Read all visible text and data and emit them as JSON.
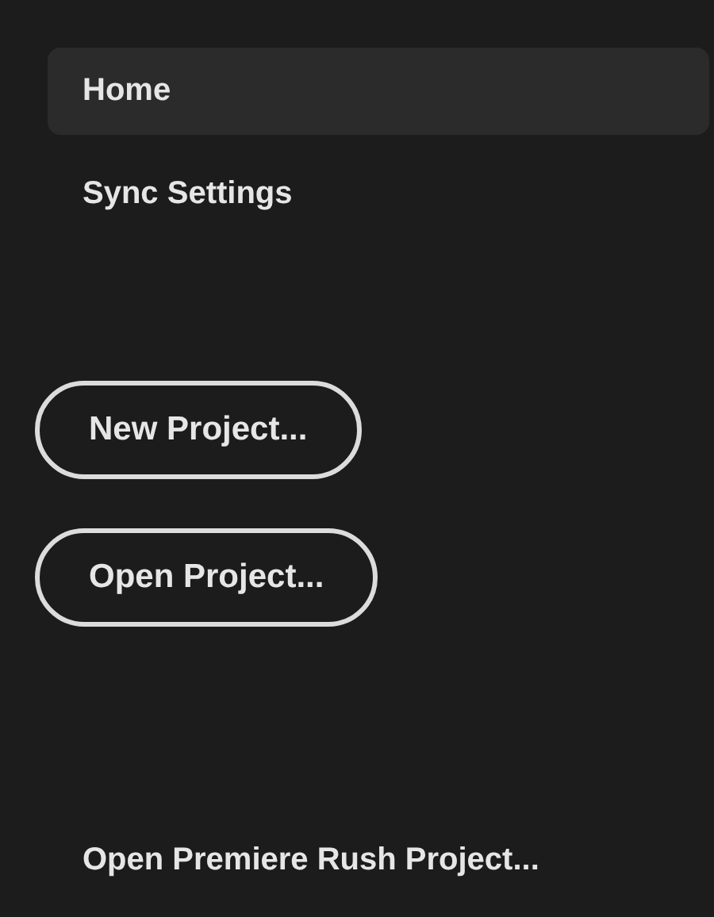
{
  "nav": [
    {
      "label": "Home",
      "selected": true
    },
    {
      "label": "Sync Settings",
      "selected": false
    }
  ],
  "buttons": [
    "New Project...",
    "Open Project..."
  ],
  "link": "Open Premiere Rush Project..."
}
